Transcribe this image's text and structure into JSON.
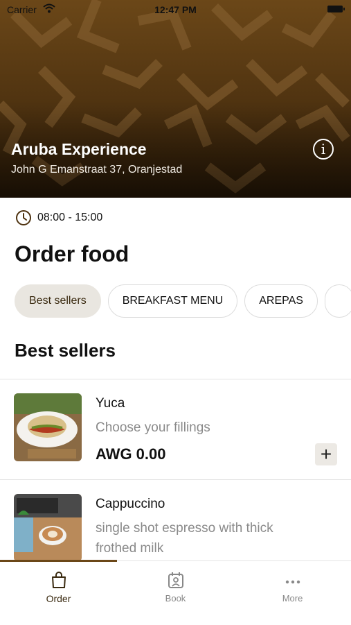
{
  "status_bar": {
    "carrier": "Carrier",
    "time": "12:47 PM"
  },
  "venue": {
    "name": "Aruba Experience",
    "address": "John G Emanstraat 37, Oranjestad",
    "hours": "08:00 - 15:00"
  },
  "page": {
    "title": "Order food",
    "section_title": "Best sellers"
  },
  "categories": [
    "Best sellers",
    "BREAKFAST MENU",
    "AREPAS",
    ""
  ],
  "items": [
    {
      "name": "Yuca",
      "description": "Choose your fillings",
      "price": "AWG 0.00"
    },
    {
      "name": "Cappuccino",
      "description": "single shot espresso with thick frothed milk",
      "price": ""
    }
  ],
  "tabbar": {
    "order": "Order",
    "book": "Book",
    "more": "More"
  },
  "colors": {
    "accent": "#6b4718",
    "chip_active_bg": "#e9e6e0",
    "muted_text": "#8a8a8a"
  },
  "icons": [
    "wifi-icon",
    "battery-icon",
    "info-icon",
    "clock-icon",
    "plus-icon",
    "bag-icon",
    "calendar-user-icon",
    "ellipsis-icon"
  ]
}
